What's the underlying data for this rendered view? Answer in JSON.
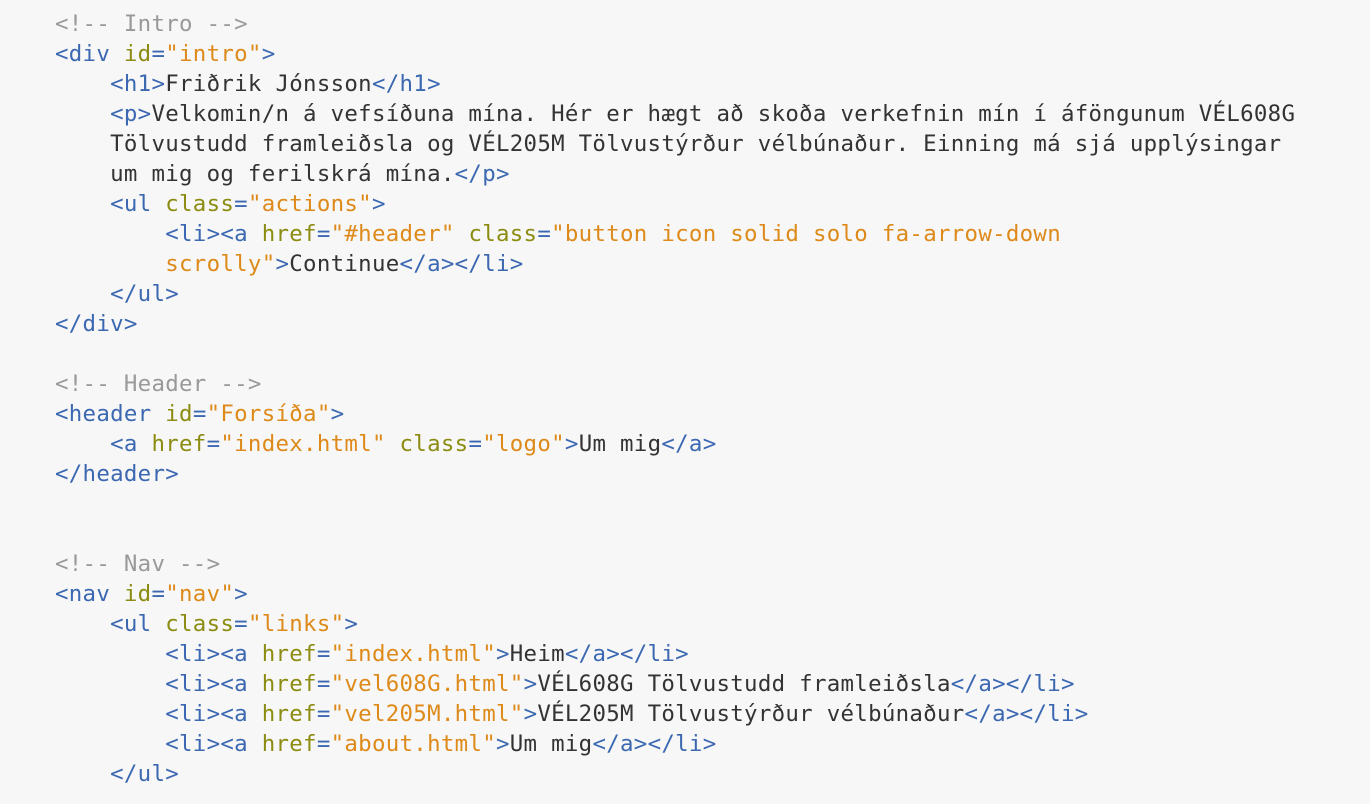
{
  "colors": {
    "background": "#f7f7f7",
    "comment": "#999999",
    "tag": "#3b68b1",
    "attribute": "#8c8c12",
    "string": "#dd8a1a",
    "text": "#333333"
  },
  "lines": [
    {
      "indent": 0,
      "tokens": [
        {
          "t": "comment",
          "v": "<!-- Intro -->"
        }
      ]
    },
    {
      "indent": 0,
      "tokens": [
        {
          "t": "tag",
          "v": "<div"
        },
        {
          "t": "text",
          "v": " "
        },
        {
          "t": "attr",
          "v": "id"
        },
        {
          "t": "punct",
          "v": "="
        },
        {
          "t": "string",
          "v": "\"intro\""
        },
        {
          "t": "tag",
          "v": ">"
        }
      ]
    },
    {
      "indent": 1,
      "tokens": [
        {
          "t": "tag",
          "v": "<h1>"
        },
        {
          "t": "text",
          "v": "Friðrik Jónsson"
        },
        {
          "t": "tag",
          "v": "</h1>"
        }
      ]
    },
    {
      "indent": 1,
      "tokens": [
        {
          "t": "tag",
          "v": "<p>"
        },
        {
          "t": "text",
          "v": "Velkomin/n á vefsíðuna mína. Hér er hægt að skoða verkefnin mín í áföngunum VÉL608G"
        }
      ]
    },
    {
      "indent": 1,
      "tokens": [
        {
          "t": "text",
          "v": "Tölvustudd framleiðsla og VÉL205M Tölvustýrður vélbúnaður. Einning má sjá upplýsingar"
        }
      ]
    },
    {
      "indent": 1,
      "tokens": [
        {
          "t": "text",
          "v": "um mig og ferilskrá mína."
        },
        {
          "t": "tag",
          "v": "</p>"
        }
      ]
    },
    {
      "indent": 1,
      "tokens": [
        {
          "t": "tag",
          "v": "<ul"
        },
        {
          "t": "text",
          "v": " "
        },
        {
          "t": "attr",
          "v": "class"
        },
        {
          "t": "punct",
          "v": "="
        },
        {
          "t": "string",
          "v": "\"actions\""
        },
        {
          "t": "tag",
          "v": ">"
        }
      ]
    },
    {
      "indent": 2,
      "tokens": [
        {
          "t": "tag",
          "v": "<li><a"
        },
        {
          "t": "text",
          "v": " "
        },
        {
          "t": "attr",
          "v": "href"
        },
        {
          "t": "punct",
          "v": "="
        },
        {
          "t": "string",
          "v": "\"#header\""
        },
        {
          "t": "text",
          "v": " "
        },
        {
          "t": "attr",
          "v": "class"
        },
        {
          "t": "punct",
          "v": "="
        },
        {
          "t": "string",
          "v": "\"button icon solid solo fa-arrow-down"
        }
      ]
    },
    {
      "indent": 2,
      "tokens": [
        {
          "t": "string",
          "v": "scrolly\""
        },
        {
          "t": "tag",
          "v": ">"
        },
        {
          "t": "text",
          "v": "Continue"
        },
        {
          "t": "tag",
          "v": "</a></li>"
        }
      ]
    },
    {
      "indent": 1,
      "tokens": [
        {
          "t": "tag",
          "v": "</ul>"
        }
      ]
    },
    {
      "indent": 0,
      "tokens": [
        {
          "t": "tag",
          "v": "</div>"
        }
      ]
    },
    {
      "indent": 0,
      "tokens": []
    },
    {
      "indent": 0,
      "tokens": [
        {
          "t": "comment",
          "v": "<!-- Header -->"
        }
      ]
    },
    {
      "indent": 0,
      "tokens": [
        {
          "t": "tag",
          "v": "<header"
        },
        {
          "t": "text",
          "v": " "
        },
        {
          "t": "attr",
          "v": "id"
        },
        {
          "t": "punct",
          "v": "="
        },
        {
          "t": "string",
          "v": "\"Forsíða\""
        },
        {
          "t": "tag",
          "v": ">"
        }
      ]
    },
    {
      "indent": 1,
      "tokens": [
        {
          "t": "tag",
          "v": "<a"
        },
        {
          "t": "text",
          "v": " "
        },
        {
          "t": "attr",
          "v": "href"
        },
        {
          "t": "punct",
          "v": "="
        },
        {
          "t": "string",
          "v": "\"index.html\""
        },
        {
          "t": "text",
          "v": " "
        },
        {
          "t": "attr",
          "v": "class"
        },
        {
          "t": "punct",
          "v": "="
        },
        {
          "t": "string",
          "v": "\"logo\""
        },
        {
          "t": "tag",
          "v": ">"
        },
        {
          "t": "text",
          "v": "Um mig"
        },
        {
          "t": "tag",
          "v": "</a>"
        }
      ]
    },
    {
      "indent": 0,
      "tokens": [
        {
          "t": "tag",
          "v": "</header>"
        }
      ]
    },
    {
      "indent": 0,
      "tokens": []
    },
    {
      "indent": 0,
      "tokens": []
    },
    {
      "indent": 0,
      "tokens": [
        {
          "t": "comment",
          "v": "<!-- Nav -->"
        }
      ]
    },
    {
      "indent": 0,
      "tokens": [
        {
          "t": "tag",
          "v": "<nav"
        },
        {
          "t": "text",
          "v": " "
        },
        {
          "t": "attr",
          "v": "id"
        },
        {
          "t": "punct",
          "v": "="
        },
        {
          "t": "string",
          "v": "\"nav\""
        },
        {
          "t": "tag",
          "v": ">"
        }
      ]
    },
    {
      "indent": 1,
      "tokens": [
        {
          "t": "tag",
          "v": "<ul"
        },
        {
          "t": "text",
          "v": " "
        },
        {
          "t": "attr",
          "v": "class"
        },
        {
          "t": "punct",
          "v": "="
        },
        {
          "t": "string",
          "v": "\"links\""
        },
        {
          "t": "tag",
          "v": ">"
        }
      ]
    },
    {
      "indent": 2,
      "tokens": [
        {
          "t": "tag",
          "v": "<li><a"
        },
        {
          "t": "text",
          "v": " "
        },
        {
          "t": "attr",
          "v": "href"
        },
        {
          "t": "punct",
          "v": "="
        },
        {
          "t": "string",
          "v": "\"index.html\""
        },
        {
          "t": "tag",
          "v": ">"
        },
        {
          "t": "text",
          "v": "Heim"
        },
        {
          "t": "tag",
          "v": "</a></li>"
        }
      ]
    },
    {
      "indent": 2,
      "tokens": [
        {
          "t": "tag",
          "v": "<li><a"
        },
        {
          "t": "text",
          "v": " "
        },
        {
          "t": "attr",
          "v": "href"
        },
        {
          "t": "punct",
          "v": "="
        },
        {
          "t": "string",
          "v": "\"vel608G.html\""
        },
        {
          "t": "tag",
          "v": ">"
        },
        {
          "t": "text",
          "v": "VÉL608G Tölvustudd framleiðsla"
        },
        {
          "t": "tag",
          "v": "</a></li>"
        }
      ]
    },
    {
      "indent": 2,
      "tokens": [
        {
          "t": "tag",
          "v": "<li><a"
        },
        {
          "t": "text",
          "v": " "
        },
        {
          "t": "attr",
          "v": "href"
        },
        {
          "t": "punct",
          "v": "="
        },
        {
          "t": "string",
          "v": "\"vel205M.html\""
        },
        {
          "t": "tag",
          "v": ">"
        },
        {
          "t": "text",
          "v": "VÉL205M Tölvustýrður vélbúnaður"
        },
        {
          "t": "tag",
          "v": "</a></li>"
        }
      ]
    },
    {
      "indent": 2,
      "tokens": [
        {
          "t": "tag",
          "v": "<li><a"
        },
        {
          "t": "text",
          "v": " "
        },
        {
          "t": "attr",
          "v": "href"
        },
        {
          "t": "punct",
          "v": "="
        },
        {
          "t": "string",
          "v": "\"about.html\""
        },
        {
          "t": "tag",
          "v": ">"
        },
        {
          "t": "text",
          "v": "Um mig"
        },
        {
          "t": "tag",
          "v": "</a></li>"
        }
      ]
    },
    {
      "indent": 1,
      "tokens": [
        {
          "t": "tag",
          "v": "</ul>"
        }
      ]
    }
  ]
}
